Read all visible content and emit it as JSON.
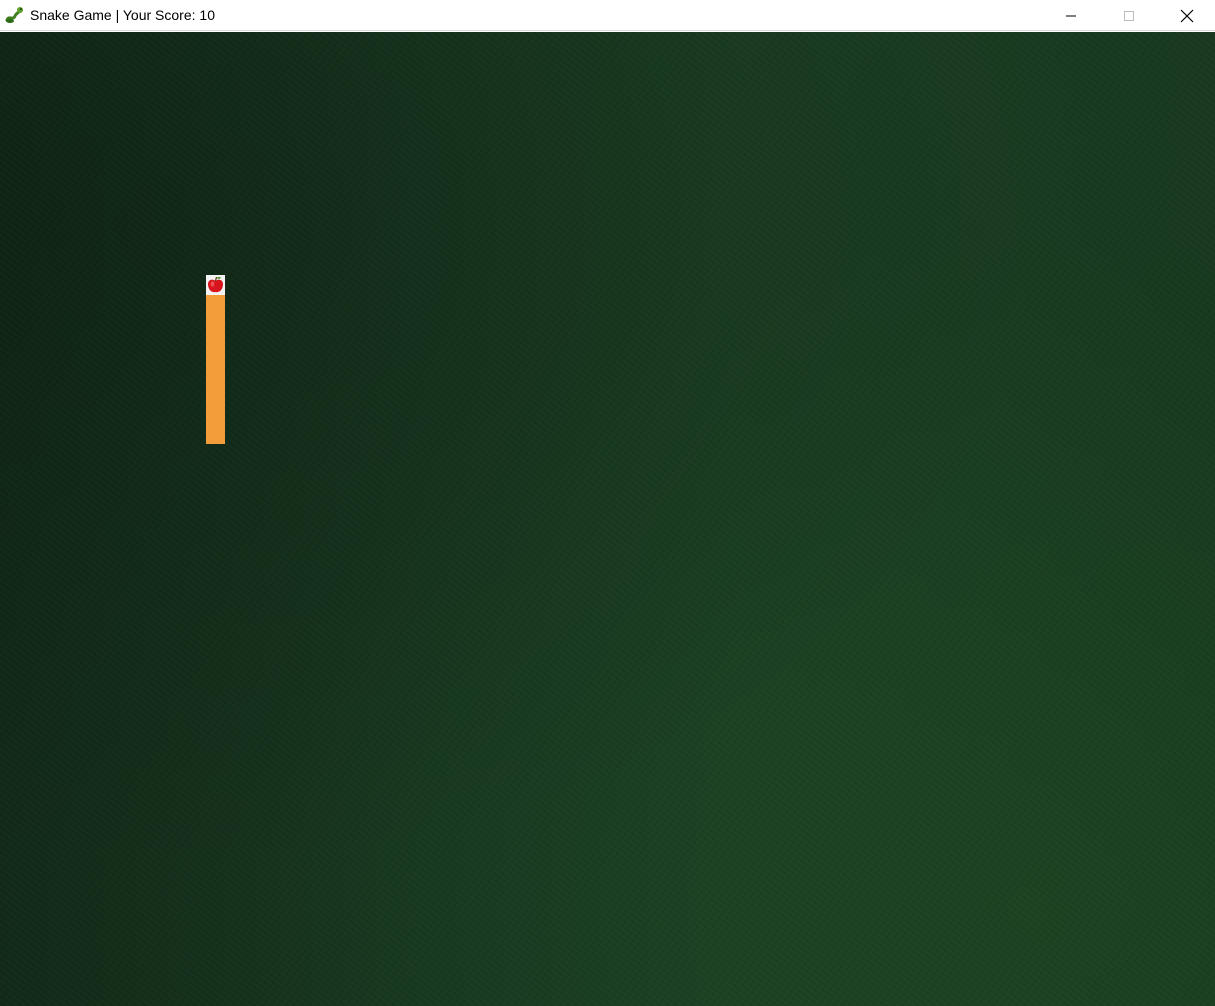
{
  "window": {
    "title": "Snake Game | Your Score: 10",
    "app_icon": "snake-icon",
    "controls": {
      "minimize": "minimize-icon",
      "maximize": "maximize-icon",
      "close": "close-icon"
    }
  },
  "game": {
    "score": 10,
    "background_color": "#173720",
    "snake_color": "#f39c3a",
    "food": "apple-icon",
    "direction": "up"
  }
}
